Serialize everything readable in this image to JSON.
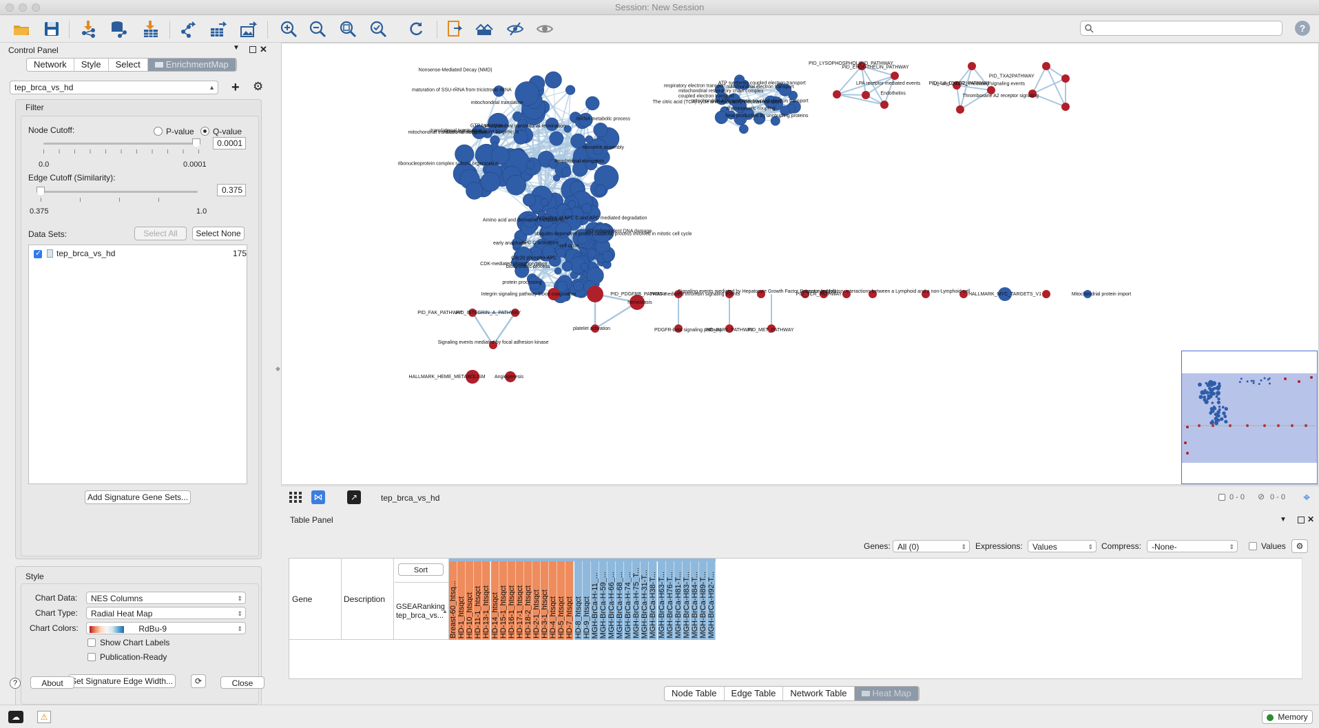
{
  "window": {
    "title": "Session: New Session"
  },
  "search": {
    "placeholder": ""
  },
  "control_panel": {
    "title": "Control Panel",
    "tabs": [
      "Network",
      "Style",
      "Select",
      "EnrichmentMap"
    ],
    "network_select": "tep_brca_vs_hd",
    "filter": {
      "title": "Filter",
      "node_cutoff_label": "Node Cutoff:",
      "pvalue_label": "P-value",
      "qvalue_label": "Q-value",
      "node_value": "0.0001",
      "node_min": "0.0",
      "node_max": "0.0001",
      "edge_cutoff_label": "Edge Cutoff (Similarity):",
      "edge_value": "0.375",
      "edge_min": "0.375",
      "edge_max": "1.0",
      "datasets_label": "Data Sets:",
      "select_all": "Select All",
      "select_none": "Select None",
      "dataset_name": "tep_brca_vs_hd",
      "dataset_count": "175",
      "add_signature": "Add Signature Gene Sets..."
    },
    "style": {
      "title": "Style",
      "chart_data_label": "Chart Data:",
      "chart_data": "NES Columns",
      "chart_type_label": "Chart Type:",
      "chart_type": "Radial Heat Map",
      "chart_colors_label": "Chart Colors:",
      "chart_colors": "RdBu-9",
      "show_labels": "Show Chart Labels",
      "publication_ready": "Publication-Ready",
      "set_edge_width": "Set Signature Edge Width..."
    },
    "about": "About",
    "close": "Close"
  },
  "network_bar": {
    "name": "tep_brca_vs_hd",
    "selected_nodes": "0 - 0",
    "hidden": "0 - 0"
  },
  "network_labels": {
    "top_left": [
      "translational termination",
      "translational elongation",
      "Mitochondrial translational termination",
      "mitochondrial translational elongation",
      "mitochondrial translation",
      "ribonucleoprotein complex subunit organization",
      "mRNA metabolic process",
      "GTP hydrolysis",
      "maturation of SSU-rRNA from tricistronic rRNA",
      "ribosomal large subunit biogenesis",
      "ribosome assembly",
      "Nonsense-Mediated Decay (NMD)",
      "Amino acid and derivative metabolism",
      "Activation of APC C and APC mediated degradation",
      "Cdc20 phospho-APC",
      "CDK-mediated phosphorylation",
      "p53-independent DNA damage",
      "ubiquitin-dependent protein catabolic process involved in mitotic cell cycle",
      "APC C activators",
      "early anaphase",
      "cell cycle",
      "biosynthetic process",
      "protein processing"
    ],
    "top_mid": [
      "mitochondrial electron transport",
      "coupled electron transport",
      "ATP synthesis coupled electron transport",
      "mitochondrial respiratory chain complex",
      "The citric acid (TCA) cycle and respiratory electron transport",
      "chemiosmotic coupling",
      "heat production by uncoupling proteins",
      "respiratory electron transport",
      "mitochondrial ATP synthesis coupled electron transport",
      "PID_ENDOTHELIN_PATHWAY",
      "Endothelins",
      "PID_LYSOPHOSPHOLIPID_PATHWAY",
      "LPA receptor mediated events"
    ],
    "top_right": [
      "PID_IL8_CXCR2_PATHWAY",
      "IL8- and CXCR2-mediated signaling events",
      "PID_TXA2PATHWAY",
      "Thromboxane A2 receptor signaling"
    ],
    "bottom": [
      "Integrin signaling pathway",
      "blood coagulation",
      "hemostasis",
      "platelet activation",
      "PID_FAK_PATHWAY",
      "PID_INTEGRIN_A_PATHWAY",
      "Signaling events mediated by focal adhesion kinase",
      "PID_PDGFRB_PATHWAY",
      "PDGFR-beta signaling pathway",
      "PAR1-mediated thrombin signaling events",
      "PID_PAR1_PATHWAY",
      "Signaling events mediated by Hepatocyte Growth Factor Receptor (c-Met)",
      "PID_MET_PATHWAY",
      "PID_TCR_PATHWAY",
      "Immunoregulatory interactions between a Lymphoid and a non-Lymphoid cell",
      "HALLMARK_MYC_TARGETS_V1",
      "Mitochondrial protein import",
      "HALLMARK_HEME_METABOLISM",
      "Angiogenesis"
    ]
  },
  "table_panel": {
    "title": "Table Panel",
    "genes_label": "Genes:",
    "genes_value": "All (0)",
    "expressions_label": "Expressions:",
    "expressions_value": "Values",
    "compress_label": "Compress:",
    "compress_value": "-None-",
    "values_label": "Values",
    "sort": "Sort",
    "gene_col": "Gene",
    "desc_col": "Description",
    "ranking_col": "GSEARanking tep_brca_vs...",
    "columns_orange": [
      "Breast-60_htsq...",
      "HD-1_htsqct",
      "HD-10_htsqct",
      "HD-11-1_htsqct",
      "HD-13-1_htsqct",
      "HD-14_htsqct",
      "HD-15-1_htsqct",
      "HD-16-1_htsqct",
      "HD-17-1_htsqct",
      "HD-18-2_htsqct",
      "HD-2-1_htsqct",
      "HD-3-1_htsqct",
      "HD-4_htsqct",
      "HD-5_htsqct",
      "HD-7_htsqct"
    ],
    "columns_blue": [
      "HD-8_htsqct",
      "HD-9_htsqct",
      "MGH-BrCa-H-11_...",
      "MGH-BrCa-H-59_...",
      "MGH-BrCa-H-66_...",
      "MGH-BrCa-H-68_...",
      "MGH-BrCa-H-74_...",
      "MGH-BrCa-H-75_T...",
      "MGH-BrCa-H-31-T...",
      "MGH-BrCa-H38-T...",
      "MGH-BrCa-H63-T...",
      "MGH-BrCa-H76-T...",
      "MGH-BrCa-H81-T...",
      "MGH-BrCa-H83-T...",
      "MGH-BrCa-H84-T...",
      "MGH-BrCa-H89-T...",
      "MGH-BrCa-H92-T..."
    ],
    "tabs": [
      "Node Table",
      "Edge Table",
      "Network Table",
      "Heat Map"
    ]
  },
  "status": {
    "memory": "Memory"
  },
  "colors": {
    "node_blue": "#2f5da8",
    "node_red": "#b0202a",
    "edge": "#a9c7e0",
    "orange_col": "#ee8c5d",
    "blue_col": "#8fb9dc",
    "tab_active": "#8e9aa8"
  }
}
